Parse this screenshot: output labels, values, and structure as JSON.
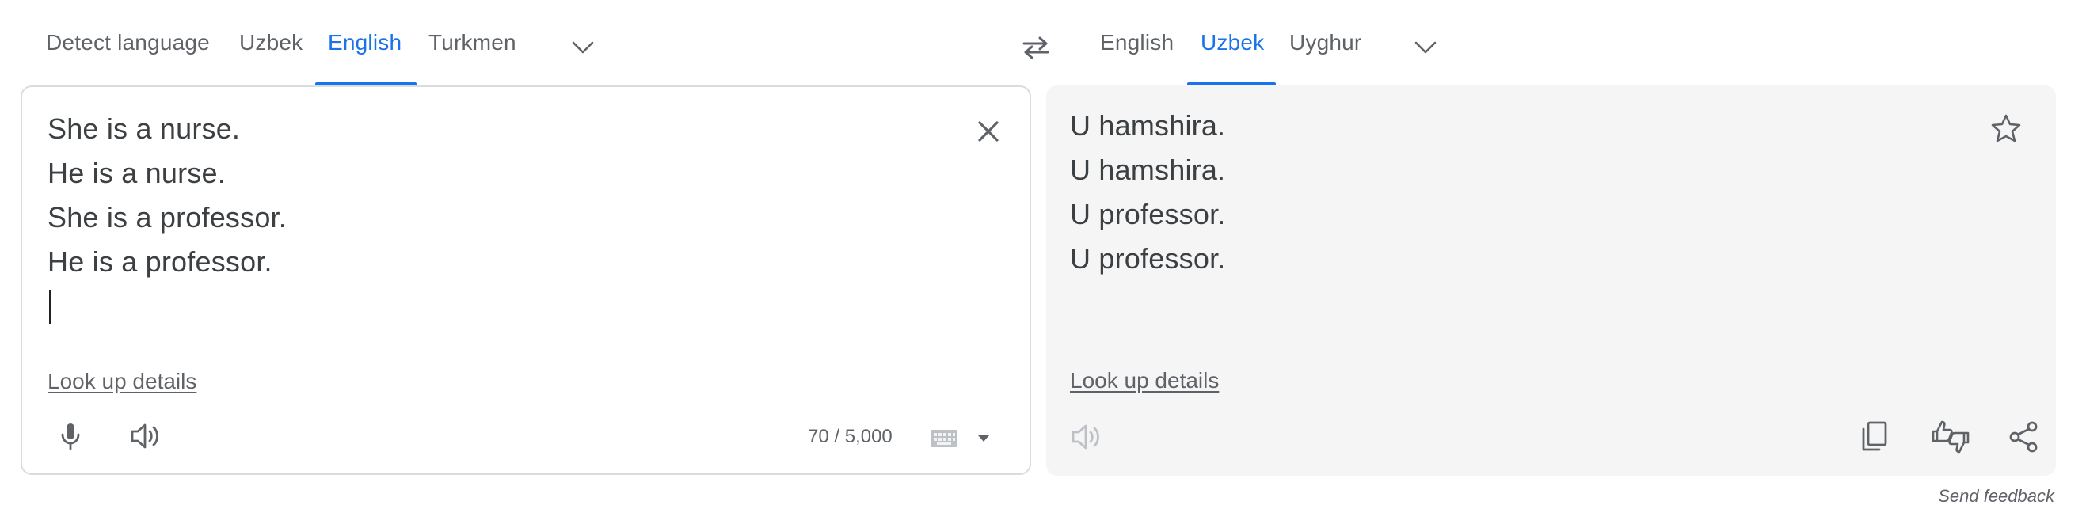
{
  "source_tabs": [
    {
      "label": "Detect language",
      "active": false
    },
    {
      "label": "Uzbek",
      "active": false
    },
    {
      "label": "English",
      "active": true
    },
    {
      "label": "Turkmen",
      "active": false
    }
  ],
  "target_tabs": [
    {
      "label": "English",
      "active": false
    },
    {
      "label": "Uzbek",
      "active": true
    },
    {
      "label": "Uyghur",
      "active": false
    }
  ],
  "icons": {
    "more_source": "chevron-down-icon",
    "swap": "swap-languages-icon",
    "more_target": "chevron-down-icon",
    "clear": "close-icon",
    "mic": "microphone-icon",
    "listen_source": "speaker-icon",
    "keyboard": "keyboard-icon",
    "keyboard_menu": "caret-down-icon",
    "star": "star-icon",
    "listen_target": "speaker-icon",
    "copy": "copy-icon",
    "rate": "thumbs-rating-icon",
    "share": "share-icon"
  },
  "source": {
    "lines": [
      "She is a nurse.",
      "He is a nurse.",
      "She is a professor.",
      "He is a professor."
    ],
    "lookup_label": "Look up details",
    "char_count": "70 / 5,000"
  },
  "target": {
    "lines": [
      "U hamshira.",
      "U hamshira.",
      "U professor.",
      "U professor."
    ],
    "lookup_label": "Look up details"
  },
  "footer": {
    "feedback_label": "Send feedback"
  },
  "colors": {
    "accent": "#1a73e8",
    "text": "#3c4043",
    "muted": "#5f6368",
    "target_bg": "#f5f5f5",
    "border": "#dadce0"
  }
}
